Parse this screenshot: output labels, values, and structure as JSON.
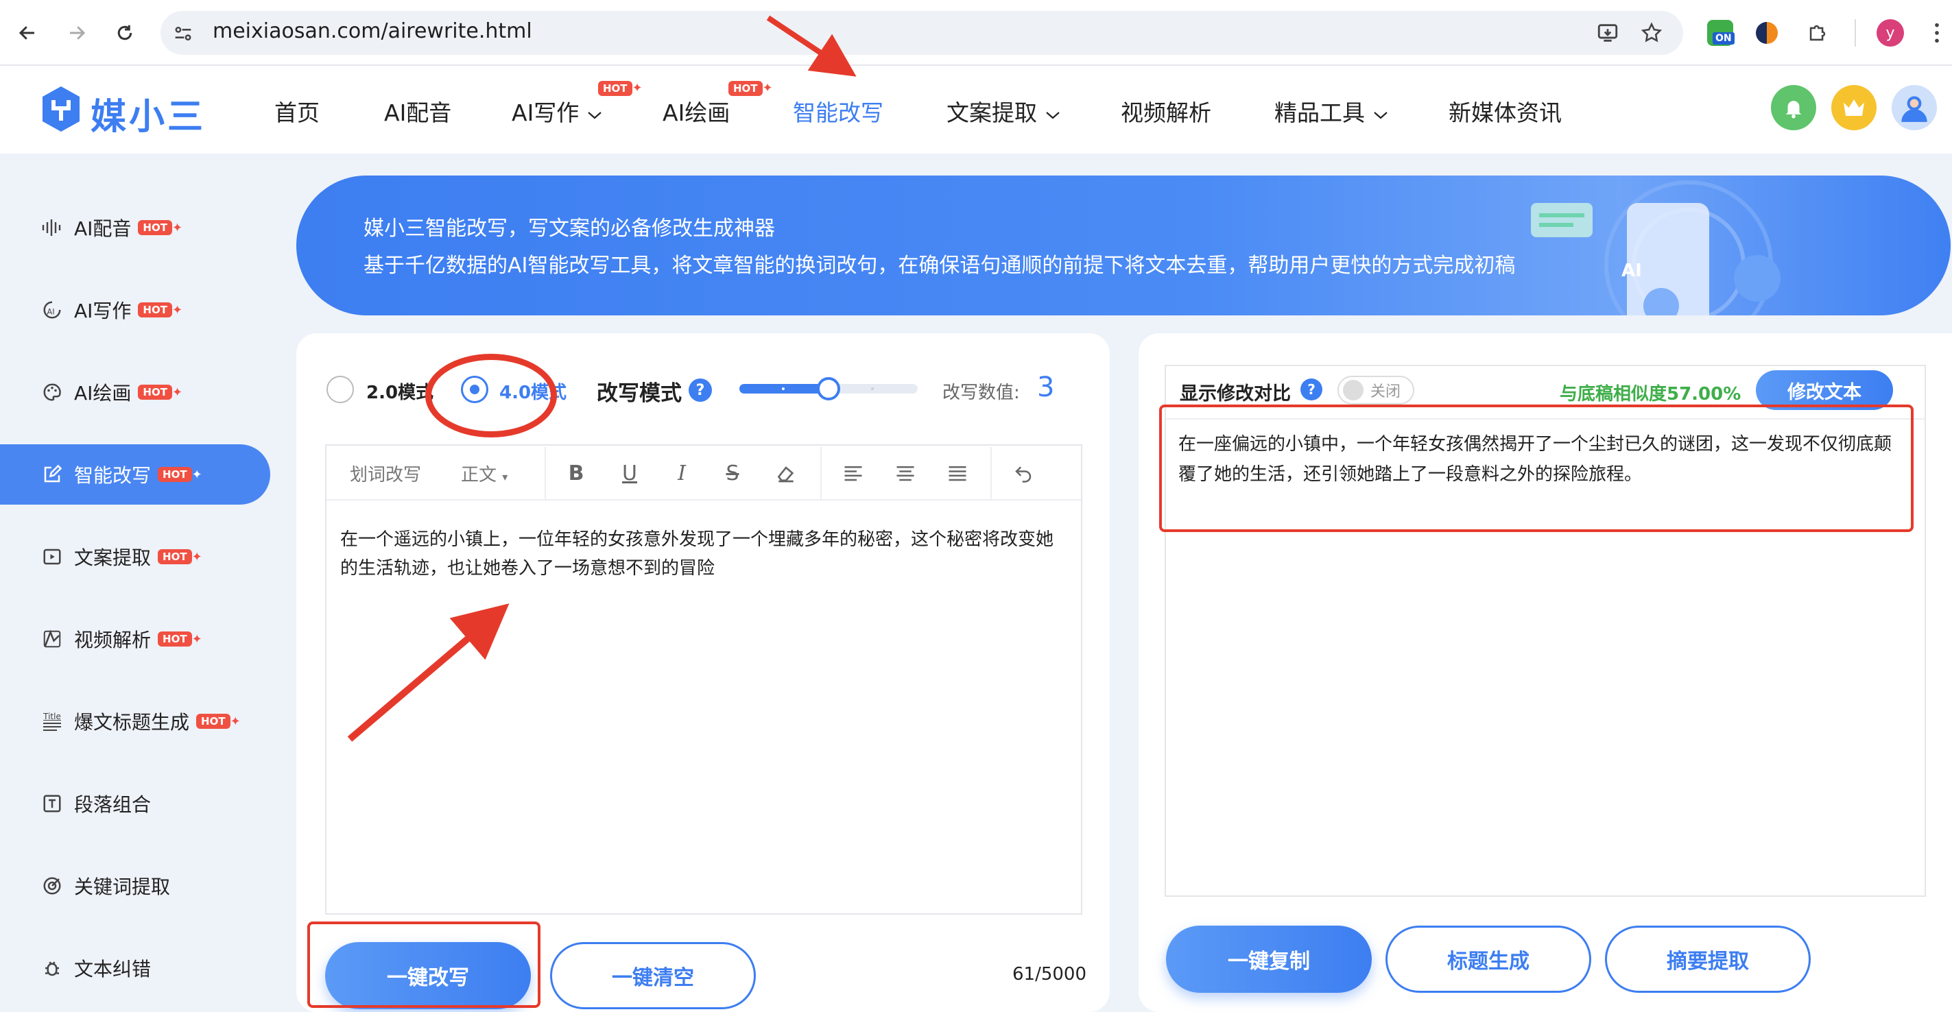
{
  "browser": {
    "url": "meixiaosan.com/airewrite.html",
    "profile_initial": "y",
    "ext_badge": "ON"
  },
  "site": {
    "logo_text": "媒小三",
    "nav": [
      {
        "label": "首页"
      },
      {
        "label": "AI配音"
      },
      {
        "label": "AI写作",
        "hot": "HOT"
      },
      {
        "label": "AI绘画",
        "hot": "HOT"
      },
      {
        "label": "智能改写"
      },
      {
        "label": "文案提取"
      },
      {
        "label": "视频解析"
      },
      {
        "label": "精品工具"
      },
      {
        "label": "新媒体资讯"
      }
    ]
  },
  "sidebar": {
    "items": [
      {
        "label": "AI配音",
        "hot": "HOT"
      },
      {
        "label": "AI写作",
        "hot": "HOT"
      },
      {
        "label": "AI绘画",
        "hot": "HOT"
      },
      {
        "label": "智能改写",
        "hot": "HOT"
      },
      {
        "label": "文案提取",
        "hot": "HOT"
      },
      {
        "label": "视频解析",
        "hot": "HOT"
      },
      {
        "label": "爆文标题生成",
        "hot": "HOT"
      },
      {
        "label": "段落组合"
      },
      {
        "label": "关键词提取"
      },
      {
        "label": "文本纠错"
      }
    ],
    "title_icon_text": "Title"
  },
  "banner": {
    "line1": "媒小三智能改写，写文案的必备修改生成神器",
    "line2": "基于千亿数据的AI智能改写工具，将文章智能的换词改句，在确保语句通顺的前提下将文本去重，帮助用户更快的方式完成初稿",
    "ai_badge": "AI"
  },
  "rewrite": {
    "mode_2": "2.0模式",
    "mode_4": "4.0模式",
    "mode_label": "改写模式",
    "value_label": "改写数值:",
    "value": "3",
    "slider_fraction": 0.5
  },
  "editor": {
    "toolbar_word": "划词改写",
    "toolbar_format": "正文",
    "content": "在一个遥远的小镇上，一位年轻的女孩意外发现了一个埋藏多年的秘密，这个秘密将改变她的生活轨迹，也让她卷入了一场意想不到的冒险",
    "char_count": "61/5000",
    "btn_rewrite": "一键改写",
    "btn_clear": "一键清空"
  },
  "result": {
    "compare_label": "显示修改对比",
    "toggle_text": "关闭",
    "similarity": "与底稿相似度57.00%",
    "modify_btn": "修改文本",
    "content": "在一座偏远的小镇中，一个年轻女孩偶然揭开了一个尘封已久的谜团，这一发现不仅彻底颠覆了她的生活，还引领她踏上了一段意料之外的探险旅程。",
    "btn_copy": "一键复制",
    "btn_title": "标题生成",
    "btn_summary": "摘要提取"
  },
  "colors": {
    "accent": "#3d7ef1",
    "annotation": "#e53a2b",
    "similarity": "#3fae49",
    "hot": "#f05042"
  }
}
